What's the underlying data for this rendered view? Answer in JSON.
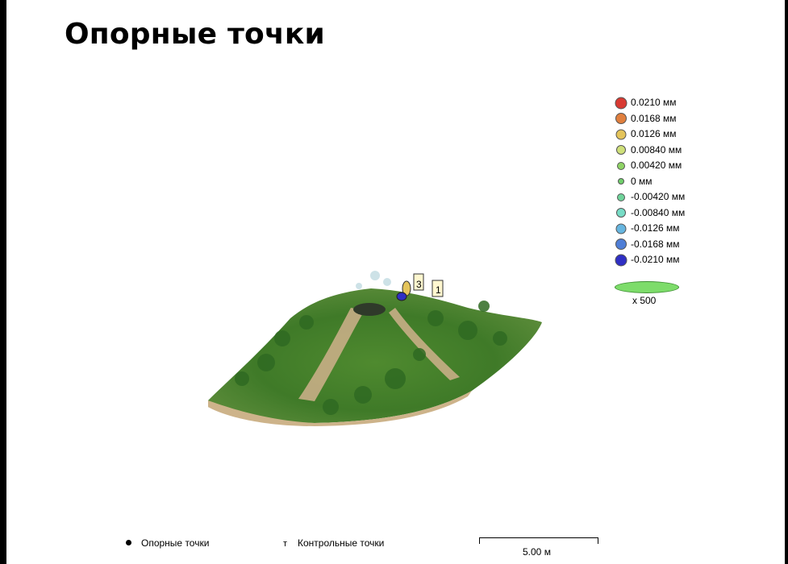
{
  "title": "Опорные точки",
  "legend": [
    {
      "label": "0.0210 мм",
      "color": "#d83a32"
    },
    {
      "label": "0.0168 мм",
      "color": "#e07f3e"
    },
    {
      "label": "0.0126 мм",
      "color": "#e4c45a"
    },
    {
      "label": "0.00840 мм",
      "color": "#cfe07a"
    },
    {
      "label": "0.00420 мм",
      "color": "#8fd466"
    },
    {
      "label": "0 мм",
      "color": "#6fcf6a"
    },
    {
      "label": "-0.00420 мм",
      "color": "#6fd39a"
    },
    {
      "label": "-0.00840 мм",
      "color": "#77dcc6"
    },
    {
      "label": "-0.0126 мм",
      "color": "#67b6e0"
    },
    {
      "label": "-0.0168 мм",
      "color": "#4f7ed6"
    },
    {
      "label": "-0.0210 мм",
      "color": "#2f2fc4"
    }
  ],
  "scale_factor": "x 500",
  "markers": [
    {
      "label": "3"
    },
    {
      "label": "1"
    }
  ],
  "footer": {
    "gcp_label": "Опорные точки",
    "check_label": "Контрольные точки",
    "check_symbol": "т",
    "scale_label": "5.00 м"
  }
}
